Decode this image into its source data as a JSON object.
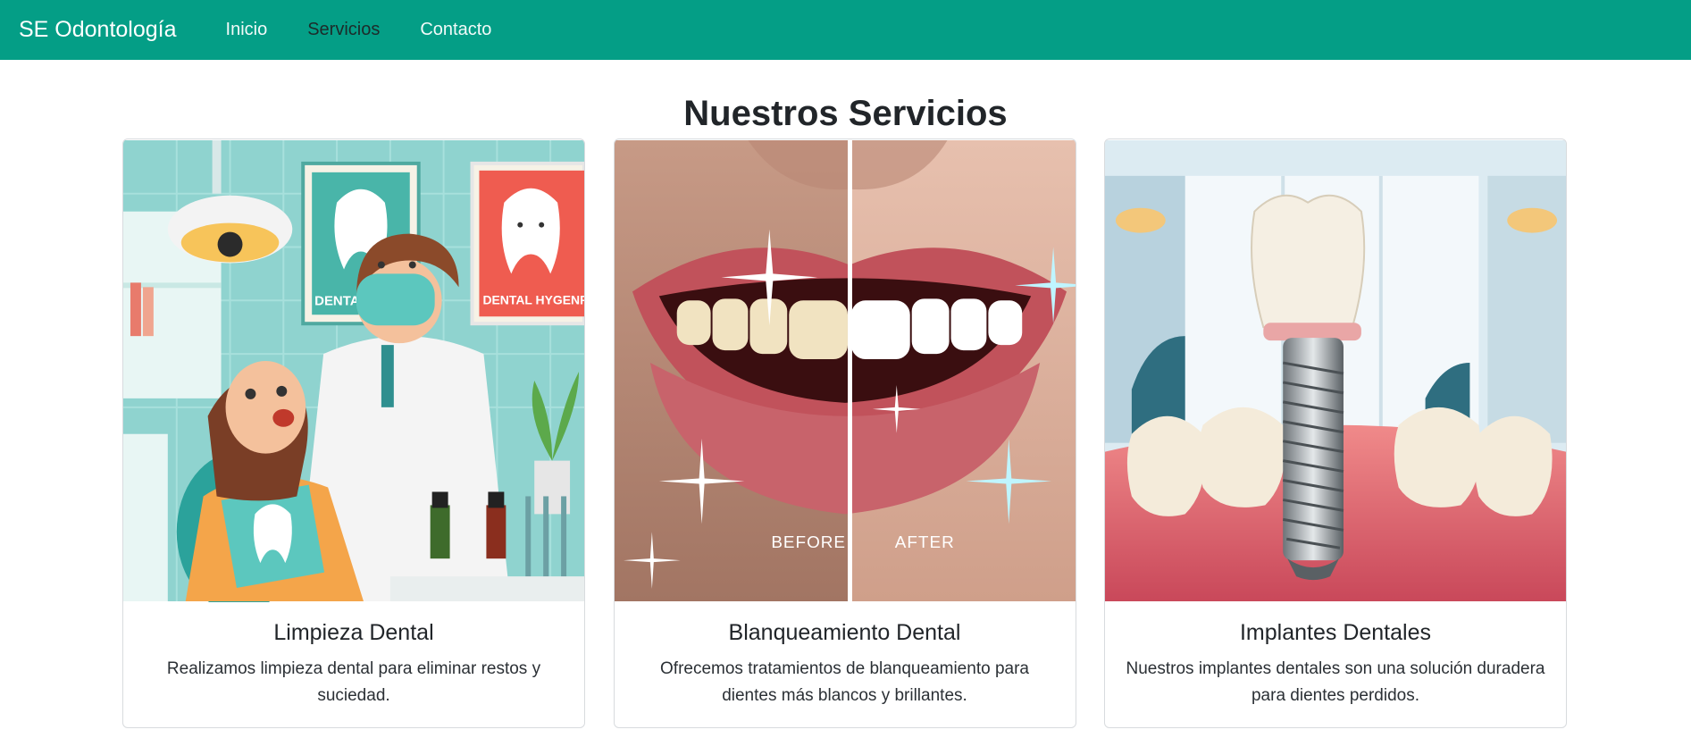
{
  "navbar": {
    "brand": "SE Odontología",
    "links": [
      {
        "label": "Inicio"
      },
      {
        "label": "Servicios"
      },
      {
        "label": "Contacto"
      }
    ],
    "bg_color": "#049e86"
  },
  "section": {
    "title": "Nuestros Servicios"
  },
  "services": [
    {
      "title": "Limpieza Dental",
      "text": "Realizamos limpieza dental para eliminar restos y suciedad.",
      "image": {
        "poster_left": "DENTAL",
        "poster_right": "DENTAL HYGENRY"
      }
    },
    {
      "title": "Blanqueamiento Dental",
      "text": "Ofrecemos tratamientos de blanqueamiento para dientes más blancos y brillantes.",
      "image": {
        "before": "BEFORE",
        "after": "AFTER"
      }
    },
    {
      "title": "Implantes Dentales",
      "text": "Nuestros implantes dentales son una solución duradera para dientes perdidos.",
      "image": {}
    }
  ]
}
